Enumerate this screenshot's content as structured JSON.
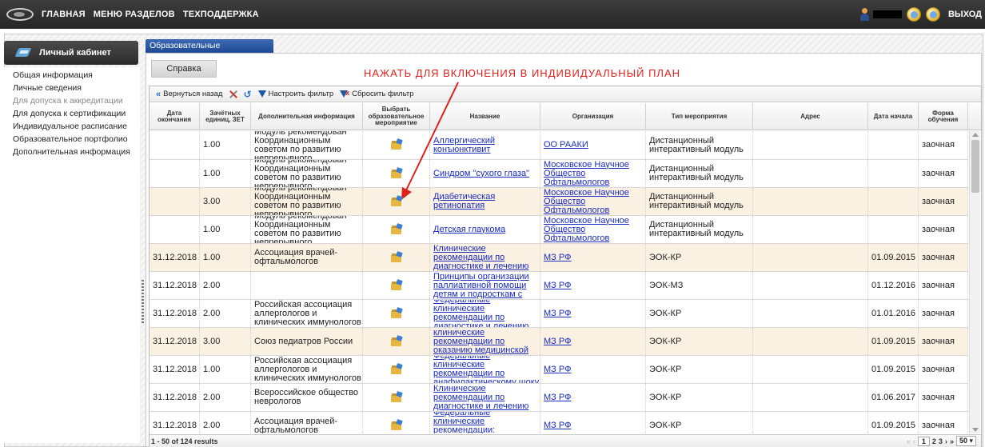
{
  "topnav": {
    "items": [
      "ГЛАВНАЯ",
      "МЕНЮ РАЗДЕЛОВ",
      "ТЕХПОДДЕРЖКА"
    ],
    "logout": "ВЫХОД"
  },
  "sidebar": {
    "title": "Личный кабинет",
    "items": [
      {
        "label": "Общая информация",
        "disabled": false
      },
      {
        "label": "Личные сведения",
        "disabled": false
      },
      {
        "label": "Для допуска к аккредитации",
        "disabled": true
      },
      {
        "label": "Для допуска к сертификации",
        "disabled": false
      },
      {
        "label": "Индивидуальное расписание",
        "disabled": false
      },
      {
        "label": "Образовательное портфолио",
        "disabled": false
      },
      {
        "label": "Дополнительная информация",
        "disabled": false
      }
    ]
  },
  "tab": {
    "label": "Образовательные мероприятия"
  },
  "help_button": "Справка",
  "annotation": "НАЖАТЬ ДЛЯ ВКЛЮЧЕНИЯ В ИНДИВИДУАЛЬНЫЙ ПЛАН",
  "annotation_color": "#e0201b",
  "toolbar": {
    "back": "Вернуться назад",
    "configure_filter": "Настроить фильтр",
    "reset_filter": "Сбросить фильтр"
  },
  "columns": [
    "Дата окончания",
    "Зачётных единиц, ЗЕТ",
    "Дополнительная информация",
    "Выбрать образовательное мероприятие",
    "Название",
    "Организация",
    "Тип мероприятия",
    "Адрес",
    "Дата начала",
    "Форма обучения"
  ],
  "rows": [
    {
      "end": "",
      "zet": "1.00",
      "info": "Модуль рекомендован Координационным советом по развитию непрерывного",
      "name": "Аллергический конъюнктивит",
      "org": "ОО РААКИ",
      "type": "Дистанционный интерактивный модуль",
      "addr": "",
      "start": "",
      "form": "заочная"
    },
    {
      "end": "",
      "zet": "1.00",
      "info": "Модуль рекомендован Координационным советом по развитию непрерывного",
      "name": "Синдром \"сухого глаза\"",
      "org": "Московское Научное Общество Офтальмологов",
      "type": "Дистанционный интерактивный модуль",
      "addr": "",
      "start": "",
      "form": "заочная"
    },
    {
      "end": "",
      "zet": "3.00",
      "info": "Модуль рекомендован Координационным советом по развитию непрерывного",
      "name": "Диабетическая ретинопатия",
      "org": "Московское Научное Общество Офтальмологов",
      "type": "Дистанционный интерактивный модуль",
      "addr": "",
      "start": "",
      "form": "заочная"
    },
    {
      "end": "",
      "zet": "1.00",
      "info": "Модуль рекомендован Координационным советом по развитию непрерывного",
      "name": "Детская глаукома",
      "org": "Московское Научное Общество Офтальмологов",
      "type": "Дистанционный интерактивный модуль",
      "addr": "",
      "start": "",
      "form": "заочная"
    },
    {
      "end": "31.12.2018",
      "zet": "1.00",
      "info": "Ассоциация врачей-офтальмологов",
      "name": "Клинические рекомендации по диагностике и лечению",
      "org": "МЗ РФ",
      "type": "ЭОК-КР",
      "addr": "",
      "start": "01.09.2015",
      "form": "заочная"
    },
    {
      "end": "31.12.2018",
      "zet": "2.00",
      "info": "",
      "name": "Принципы организации паллиативной помощи детям и подросткам с",
      "org": "МЗ РФ",
      "type": "ЭОК-МЗ",
      "addr": "",
      "start": "01.12.2016",
      "form": "заочная"
    },
    {
      "end": "31.12.2018",
      "zet": "2.00",
      "info": "Российская ассоциация аллергологов и клинических иммунологов",
      "name": "Федеральные клинические рекомендации по диагностике и лечению",
      "org": "МЗ РФ",
      "type": "ЭОК-КР",
      "addr": "",
      "start": "01.01.2016",
      "form": "заочная"
    },
    {
      "end": "31.12.2018",
      "zet": "3.00",
      "info": "Союз педиатров России",
      "name": "Федеральные клинические рекомендации по оказанию медицинской помощи",
      "org": "МЗ РФ",
      "type": "ЭОК-КР",
      "addr": "",
      "start": "01.09.2015",
      "form": "заочная"
    },
    {
      "end": "31.12.2018",
      "zet": "1.00",
      "info": "Российская ассоциация аллергологов и клинических иммунологов",
      "name": "Федеральные клинические рекомендации по анафилактическому шоку",
      "org": "МЗ РФ",
      "type": "ЭОК-КР",
      "addr": "",
      "start": "01.09.2015",
      "form": "заочная"
    },
    {
      "end": "31.12.2018",
      "zet": "2.00",
      "info": "Всероссийское общество неврологов",
      "name": "Клинические рекомендации по диагностике и лечению",
      "org": "МЗ РФ",
      "type": "ЭОК-КР",
      "addr": "",
      "start": "01.06.2017",
      "form": "заочная"
    },
    {
      "end": "31.12.2018",
      "zet": "2.00",
      "info": "Ассоциация врачей-офтальмологов",
      "name": "Федеральные клинические рекомендации: диагностика и лечение",
      "org": "МЗ РФ",
      "type": "ЭОК-КР",
      "addr": "",
      "start": "01.09.2015",
      "form": "заочная"
    }
  ],
  "footer": {
    "results": "1 - 50 of 124 results",
    "pager": {
      "first": "«",
      "prev": "‹",
      "pages": [
        "1",
        "2",
        "3"
      ],
      "current_page": "1",
      "next": "›",
      "last": "»",
      "page_size": "50"
    }
  }
}
